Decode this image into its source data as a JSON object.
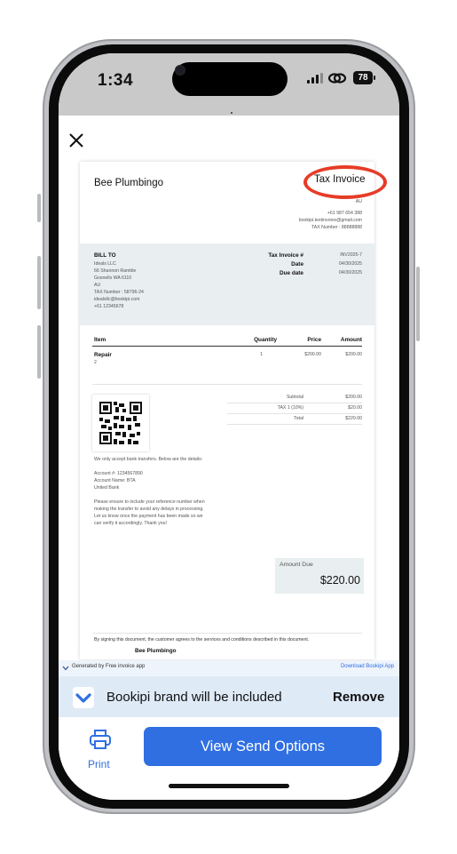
{
  "status_bar": {
    "time": "1:34",
    "battery": "78"
  },
  "invoice": {
    "company_name": "Bee Plumbingo",
    "title": "Tax Invoice",
    "sender": {
      "country": "AU",
      "phone": "+61 987 654 388",
      "email": "bookipi.testinvoice@gmail.com",
      "tax_number": "TAX Number : 88888888"
    },
    "bill_to": {
      "label": "BILL TO",
      "lines": [
        "Ideals LLC",
        "66 Shannon Ramble",
        "Gosnells WA 6110",
        "AU",
        "TAX Number : 58796-24",
        "idealsllc@bookipi.com",
        "+61 12345678"
      ]
    },
    "meta": [
      {
        "label": "Tax Invoice #",
        "value": "INV2025-7"
      },
      {
        "label": "Date",
        "value": "04/30/2025"
      },
      {
        "label": "Due date",
        "value": "04/30/2025"
      }
    ],
    "columns": {
      "item": "Item",
      "quantity": "Quantity",
      "price": "Price",
      "amount": "Amount"
    },
    "items": [
      {
        "name": "Repair",
        "desc": "2",
        "quantity": "1",
        "price": "$200.00",
        "amount": "$200.00"
      }
    ],
    "totals": [
      {
        "label": "Subtotal",
        "value": "$200.00"
      },
      {
        "label": "TAX 1 (10%)",
        "value": "$20.00"
      },
      {
        "label": "Total",
        "value": "$220.00"
      }
    ],
    "payment_note": "We only accept bank transfers. Below are the details:",
    "bank_lines": [
      "Account #: 1234567890",
      "Account Name: BTA",
      "United Bank"
    ],
    "reference_lines": [
      "Please ensure to include your reference number when",
      "making the transfer to avoid any delays in processing.",
      "Let us know once the payment has been made so we",
      "can verify it accordingly. Thank you!"
    ],
    "amount_due_label": "Amount Due",
    "amount_due_value": "$220.00",
    "signature_text": "By signing this document, the customer agrees to the services and conditions described in this document.",
    "signature_name": "Bee Plumbingo"
  },
  "banner": {
    "generated_by": "Generated by Free invoice app",
    "download_link": "Download Bookipi App",
    "brand_text": "Bookipi brand will be included",
    "remove_label": "Remove"
  },
  "actions": {
    "print_label": "Print",
    "send_label": "View Send Options"
  },
  "colors": {
    "accent": "#2f6fe2",
    "annotation": "#e63c27",
    "panel": "#e9eef0"
  }
}
